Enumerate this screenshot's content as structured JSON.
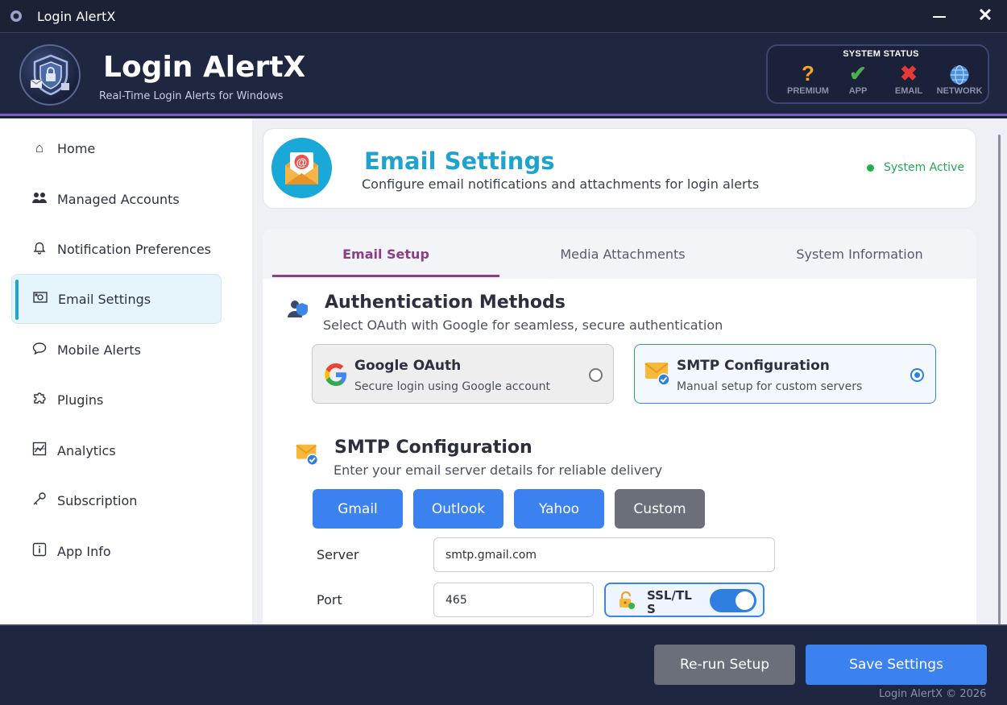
{
  "window": {
    "title": "Login AlertX"
  },
  "header": {
    "app_name": "Login AlertX",
    "tagline": "Real-Time Login Alerts for Windows"
  },
  "system_status": {
    "title": "SYSTEM STATUS",
    "items": [
      {
        "label": "PREMIUM",
        "icon": "question-icon",
        "color": "#f5a623"
      },
      {
        "label": "APP",
        "icon": "check-icon",
        "color": "#4caf50"
      },
      {
        "label": "EMAIL",
        "icon": "x-icon",
        "color": "#e53935"
      },
      {
        "label": "NETWORK",
        "icon": "globe-icon",
        "color": "#4a8fe2"
      }
    ]
  },
  "sidebar": {
    "items": [
      {
        "label": "Home",
        "icon": "home-icon"
      },
      {
        "label": "Managed Accounts",
        "icon": "users-icon"
      },
      {
        "label": "Notification Preferences",
        "icon": "bell-icon"
      },
      {
        "label": "Email Settings",
        "icon": "email-icon",
        "active": true
      },
      {
        "label": "Mobile Alerts",
        "icon": "chat-icon"
      },
      {
        "label": "Plugins",
        "icon": "puzzle-icon"
      },
      {
        "label": "Analytics",
        "icon": "chart-icon"
      },
      {
        "label": "Subscription",
        "icon": "key-icon"
      },
      {
        "label": "App Info",
        "icon": "info-icon"
      }
    ]
  },
  "page": {
    "title": "Email Settings",
    "subtitle": "Configure email notifications and attachments for login alerts",
    "status": "System Active"
  },
  "tabs": [
    {
      "label": "Email Setup",
      "active": true
    },
    {
      "label": "Media Attachments"
    },
    {
      "label": "System Information"
    }
  ],
  "auth": {
    "title": "Authentication Methods",
    "subtitle": "Select OAuth with Google for seamless, secure authentication",
    "options": [
      {
        "title": "Google OAuth",
        "subtitle": "Secure login using Google account",
        "selected": false
      },
      {
        "title": "SMTP Configuration",
        "subtitle": "Manual setup for custom servers",
        "selected": true
      }
    ]
  },
  "smtp": {
    "title": "SMTP Configuration",
    "subtitle": "Enter your email server details for reliable delivery",
    "presets": [
      "Gmail",
      "Outlook",
      "Yahoo",
      "Custom"
    ],
    "server_label": "Server",
    "server_value": "smtp.gmail.com",
    "port_label": "Port",
    "port_value": "465",
    "ssl_label": "SSL/TLS",
    "ssl_enabled": true
  },
  "footer": {
    "rerun_label": "Re-run Setup",
    "save_label": "Save Settings",
    "copyright": "Login AlertX © 2026"
  }
}
